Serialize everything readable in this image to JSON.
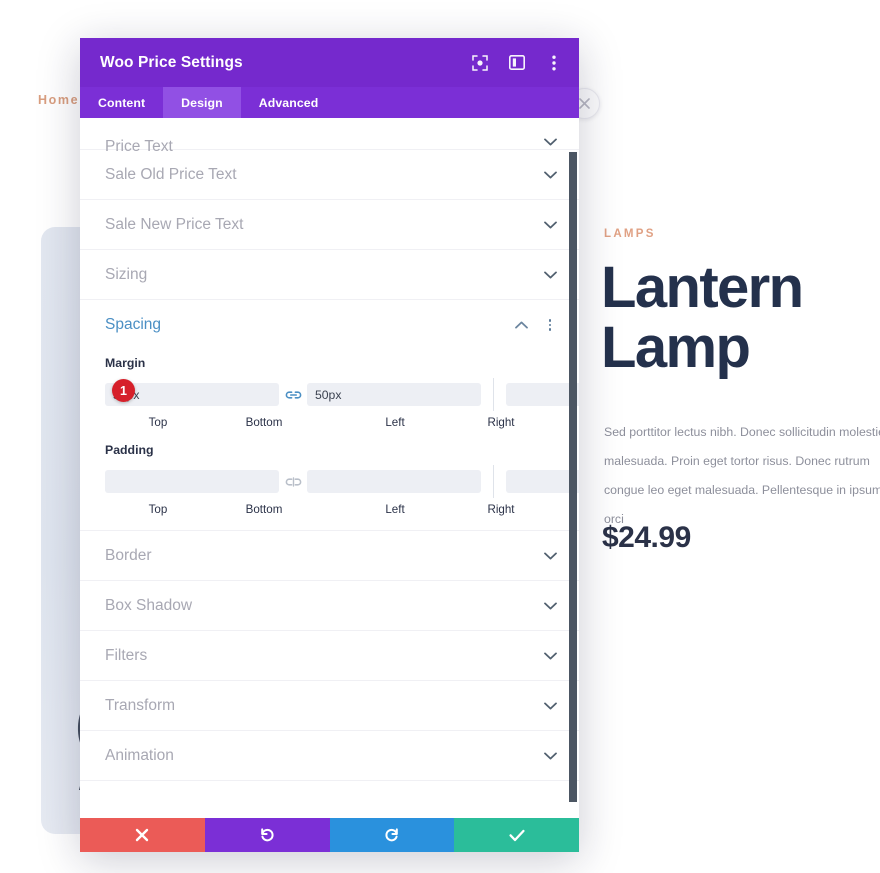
{
  "background": {
    "breadcrumb": "Home",
    "close_icon": "close-circle-icon",
    "category": "LAMPS",
    "product_title": "Lantern Lamp",
    "description": "Sed porttitor lectus nibh. Donec sollicitudin molestie malesuada. Proin eget tortor risus. Donec rutrum congue leo eget malesuada. Pellentesque in ipsum id orci",
    "price": "$24.99",
    "card_art": "lamp-illustration"
  },
  "modal": {
    "title": "Woo Price Settings",
    "header_icons": [
      {
        "name": "focus-target-icon"
      },
      {
        "name": "layout-panel-icon"
      },
      {
        "name": "more-vertical-icon"
      }
    ],
    "tabs": [
      {
        "label": "Content",
        "active": false
      },
      {
        "label": "Design",
        "active": true
      },
      {
        "label": "Advanced",
        "active": false
      }
    ],
    "sections_above": [
      {
        "label": "Price Text",
        "expanded": false
      },
      {
        "label": "Sale Old Price Text",
        "expanded": false
      },
      {
        "label": "Sale New Price Text",
        "expanded": false
      },
      {
        "label": "Sizing",
        "expanded": false
      }
    ],
    "spacing": {
      "title": "Spacing",
      "expanded": true,
      "kebab": "more-vertical-icon",
      "margin": {
        "group_label": "Margin",
        "top_value": "50px",
        "bottom_value": "50px",
        "left_value": "",
        "right_value": "",
        "top_label": "Top",
        "bottom_label": "Bottom",
        "left_label": "Left",
        "right_label": "Right",
        "link_tb_state": "linked",
        "link_lr_state": "unlinked",
        "badge": "1"
      },
      "padding": {
        "group_label": "Padding",
        "top_value": "",
        "bottom_value": "",
        "left_value": "",
        "right_value": "",
        "top_label": "Top",
        "bottom_label": "Bottom",
        "left_label": "Left",
        "right_label": "Right",
        "link_tb_state": "unlinked",
        "link_lr_state": "unlinked"
      }
    },
    "sections_below": [
      {
        "label": "Border",
        "expanded": false
      },
      {
        "label": "Box Shadow",
        "expanded": false
      },
      {
        "label": "Filters",
        "expanded": false
      },
      {
        "label": "Transform",
        "expanded": false
      },
      {
        "label": "Animation",
        "expanded": false
      }
    ],
    "footer_buttons": [
      {
        "name": "cancel-button",
        "icon": "close-icon"
      },
      {
        "name": "undo-button",
        "icon": "undo-icon"
      },
      {
        "name": "redo-button",
        "icon": "redo-icon"
      },
      {
        "name": "save-button",
        "icon": "check-icon"
      }
    ]
  },
  "colors": {
    "header_purple": "#7529CD",
    "tab_purple": "#7B2FD6",
    "tab_active_purple": "#9150E4",
    "section_active_blue": "#4B8FC4",
    "badge_red": "#D6202A",
    "cancel_red": "#EB5B57",
    "redo_blue": "#2A91DD",
    "save_teal": "#2BBD9A",
    "accent_tan": "#E0A184",
    "title_navy": "#24314C"
  }
}
